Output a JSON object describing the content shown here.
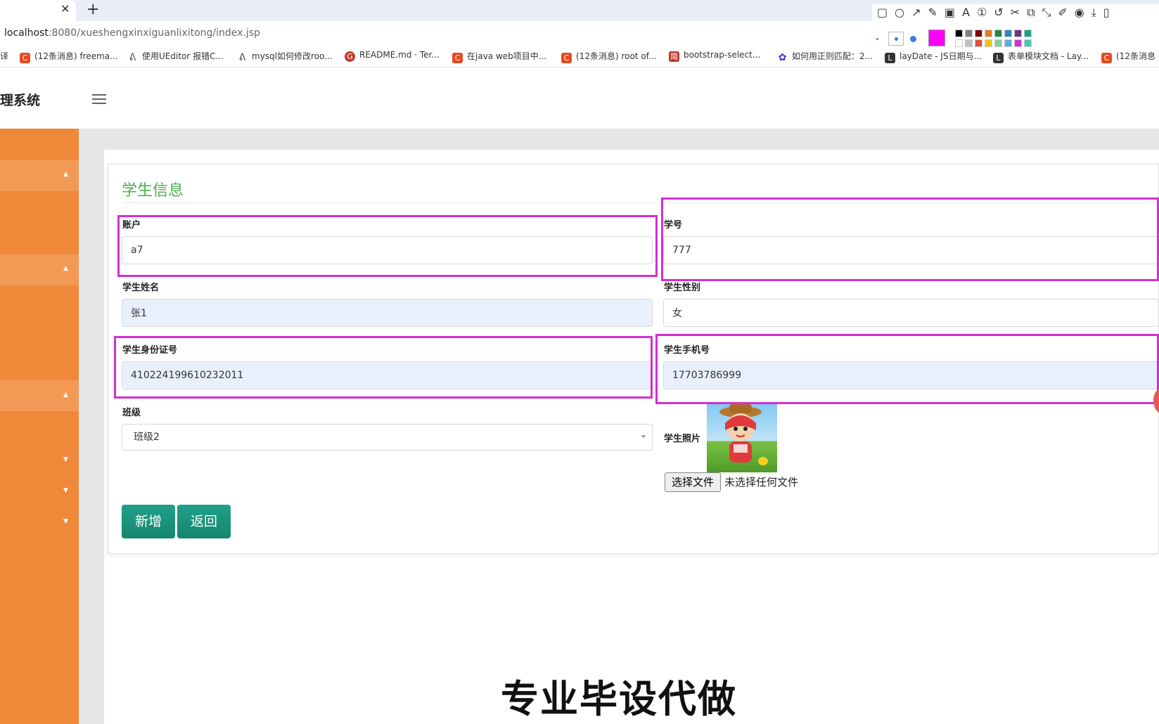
{
  "browser": {
    "url_host": "localhost",
    "url_path": ":8080/xueshengxinxiguanlixitong/index.jsp",
    "bookmarks": [
      {
        "icon": "u",
        "label": "译"
      },
      {
        "icon": "c",
        "label": "(12条消息) freema..."
      },
      {
        "icon": "u",
        "label": "使用UEditor 报错C..."
      },
      {
        "icon": "u",
        "label": "mysql如何修改roo..."
      },
      {
        "icon": "g",
        "label": "README.md · Ter..."
      },
      {
        "icon": "c",
        "label": "在java web项目中..."
      },
      {
        "icon": "c",
        "label": "(12条消息) root of..."
      },
      {
        "icon": "j",
        "label": "bootstrap-select..."
      },
      {
        "icon": "b",
        "label": "如何用正则匹配：2..."
      },
      {
        "icon": "l",
        "label": "layDate - JS日期与..."
      },
      {
        "icon": "l",
        "label": "表单模块文档 - Lay..."
      },
      {
        "icon": "c",
        "label": "(12条消息"
      }
    ]
  },
  "app": {
    "brand": "理系统"
  },
  "form": {
    "title": "学生信息",
    "account": {
      "label": "账户",
      "value": "a7"
    },
    "student_no": {
      "label": "学号",
      "value": "777"
    },
    "name": {
      "label": "学生姓名",
      "value": "张1"
    },
    "gender": {
      "label": "学生性别",
      "value": "女"
    },
    "id_card": {
      "label": "学生身份证号",
      "value": "410224199610232011"
    },
    "phone": {
      "label": "学生手机号",
      "value": "17703786999"
    },
    "class": {
      "label": "班级",
      "value": "班级2"
    },
    "photo": {
      "label": "学生照片",
      "choose_label": "选择文件",
      "no_file": "未选择任何文件"
    },
    "add_button": "新增",
    "back_button": "返回"
  },
  "overlay": {
    "watermark": "专业毕设代做",
    "highlight_color": "#d22fd2",
    "palette": [
      "#000000",
      "#808080",
      "#800000",
      "#e67e22",
      "#1e8449",
      "#2e86c1",
      "#6c3483",
      "#17a589",
      "#ffffff",
      "#c0c0c0",
      "#e74c3c",
      "#f1c40f",
      "#7dcea0",
      "#5dade2",
      "#d22fd2",
      "#48c9b0"
    ]
  },
  "colors": {
    "sidebar": "#f0883a",
    "title": "#4caf50",
    "button": "#1a9a82"
  }
}
